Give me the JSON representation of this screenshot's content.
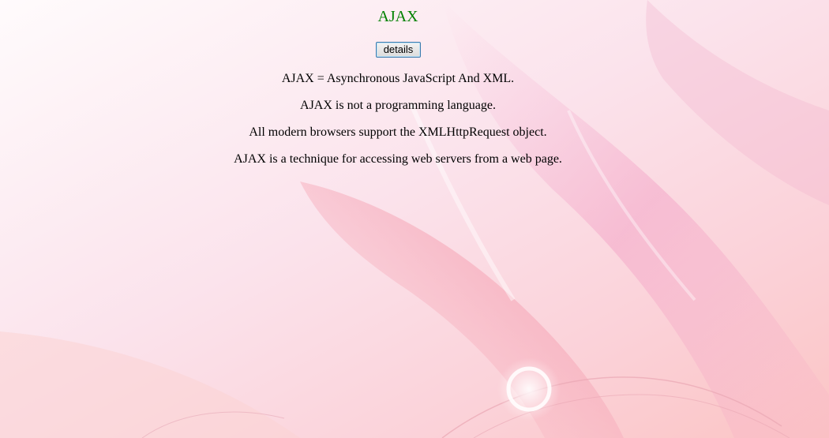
{
  "page": {
    "title": "AJAX",
    "details_button": "details"
  },
  "paragraphs": [
    "AJAX = Asynchronous JavaScript And XML.",
    "AJAX is not a programming language.",
    "All modern browsers support the XMLHttpRequest object.",
    "AJAX is a technique for accessing web servers from a web page."
  ],
  "colors": {
    "title": "#008000",
    "background": "#fdeef2",
    "button_border": "#3d7bad"
  }
}
